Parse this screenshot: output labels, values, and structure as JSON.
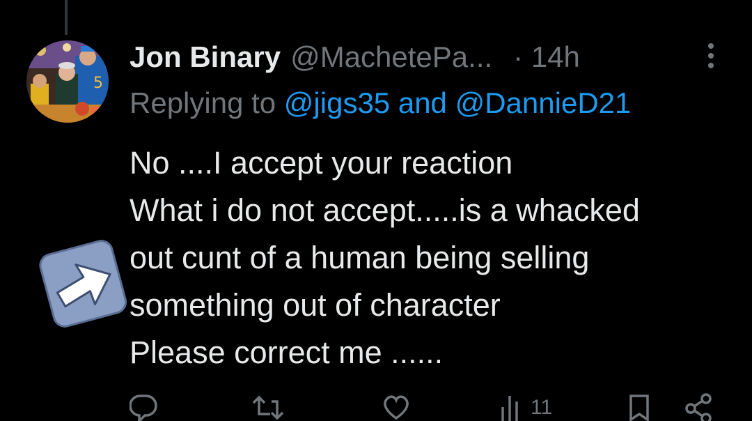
{
  "tweet": {
    "display_name": "Jon Binary",
    "handle": "@MachetePa...",
    "time": "· 14h",
    "replying_prefix": "Replying to ",
    "replying_mention_1": "@jigs35",
    "replying_and": " and ",
    "replying_mention_2": "@DannieD21",
    "text_lines": [
      "No ....I accept your reaction",
      "What i do not accept.....is a whacked",
      "out cunt of a human being selling",
      "something out of character",
      "Please correct me ......"
    ]
  },
  "actions": {
    "views": "11",
    "icons": [
      "reply-icon",
      "retweet-icon",
      "like-icon",
      "views-icon",
      "bookmark-icon",
      "share-icon"
    ]
  },
  "colors": {
    "background": "#000000",
    "primary_text": "#e7e9ea",
    "secondary_text": "#71767b",
    "link": "#1d9bf0",
    "overlay_arrow_box": "#8b9fc4"
  }
}
